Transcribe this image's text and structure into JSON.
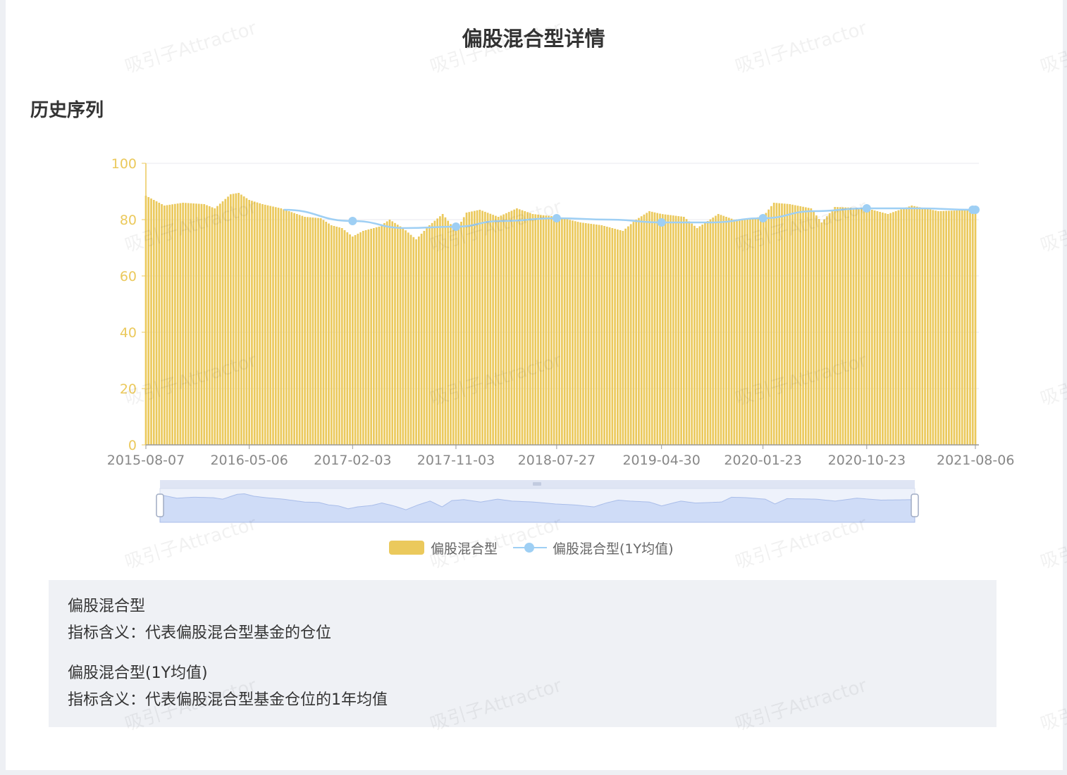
{
  "title": "偏股混合型详情",
  "section_title": "历史序列",
  "watermark": "吸引子Attractor",
  "colors": {
    "bar": "#ebc95c",
    "line": "#9ecff4",
    "axis_label": "#ebc95c",
    "zoom_fill": "#cfdcf7"
  },
  "legend": [
    {
      "name": "偏股混合型",
      "icon": "bar-swatch"
    },
    {
      "name": "偏股混合型(1Y均值)",
      "icon": "line-dot-swatch"
    }
  ],
  "descriptions": [
    {
      "name": "偏股混合型",
      "meaning": "指标含义：代表偏股混合型基金的仓位"
    },
    {
      "name": "偏股混合型(1Y均值)",
      "meaning": "指标含义：代表偏股混合型基金仓位的1年均值"
    }
  ],
  "chart_data": {
    "type": "bar",
    "x_ticks": [
      "2015-08-07",
      "2016-05-06",
      "2017-02-03",
      "2017-11-03",
      "2018-07-27",
      "2019-04-30",
      "2020-01-23",
      "2020-10-23",
      "2021-08-06"
    ],
    "ylim": [
      0,
      100
    ],
    "y_ticks": [
      0,
      20,
      40,
      60,
      80,
      100
    ],
    "grid": true,
    "legend_position": "bottom",
    "series": [
      {
        "name": "偏股混合型",
        "type": "bar",
        "anchors": [
          [
            "2015-08-07",
            88.5
          ],
          [
            "2015-09-25",
            85
          ],
          [
            "2015-11-13",
            86
          ],
          [
            "2016-01-08",
            85.5
          ],
          [
            "2016-02-05",
            84
          ],
          [
            "2016-03-18",
            89
          ],
          [
            "2016-04-08",
            89.5
          ],
          [
            "2016-05-06",
            87
          ],
          [
            "2016-06-10",
            85.5
          ],
          [
            "2016-07-29",
            84
          ],
          [
            "2016-09-30",
            81
          ],
          [
            "2016-11-11",
            80.5
          ],
          [
            "2016-12-09",
            78
          ],
          [
            "2017-01-06",
            77
          ],
          [
            "2017-02-03",
            74
          ],
          [
            "2017-03-03",
            76
          ],
          [
            "2017-04-14",
            77.5
          ],
          [
            "2017-05-12",
            80
          ],
          [
            "2017-06-16",
            77
          ],
          [
            "2017-07-21",
            73
          ],
          [
            "2017-08-25",
            78
          ],
          [
            "2017-09-29",
            82
          ],
          [
            "2017-11-03",
            76
          ],
          [
            "2017-12-01",
            82.5
          ],
          [
            "2018-01-05",
            83.5
          ],
          [
            "2018-02-23",
            81
          ],
          [
            "2018-04-13",
            84
          ],
          [
            "2018-05-25",
            82
          ],
          [
            "2018-07-27",
            81
          ],
          [
            "2018-09-28",
            79
          ],
          [
            "2018-11-23",
            78
          ],
          [
            "2019-01-18",
            76
          ],
          [
            "2019-02-22",
            80
          ],
          [
            "2019-03-29",
            83
          ],
          [
            "2019-04-30",
            82
          ],
          [
            "2019-06-28",
            81
          ],
          [
            "2019-08-02",
            77
          ],
          [
            "2019-09-27",
            82
          ],
          [
            "2019-11-08",
            80
          ],
          [
            "2020-01-23",
            81
          ],
          [
            "2020-02-21",
            86
          ],
          [
            "2020-04-03",
            85.5
          ],
          [
            "2020-05-29",
            84
          ],
          [
            "2020-06-26",
            79
          ],
          [
            "2020-07-31",
            84.5
          ],
          [
            "2020-10-23",
            84
          ],
          [
            "2020-12-18",
            82
          ],
          [
            "2021-02-19",
            85
          ],
          [
            "2021-04-30",
            83
          ],
          [
            "2021-08-06",
            83.5
          ]
        ]
      },
      {
        "name": "偏股混合型(1Y均值)",
        "type": "line",
        "values": [
          [
            "2016-08-05",
            83.5
          ],
          [
            "2017-02-03",
            79.5
          ],
          [
            "2017-06-23",
            77
          ],
          [
            "2017-11-03",
            77.5
          ],
          [
            "2018-03-02",
            79.5
          ],
          [
            "2018-07-27",
            80.5
          ],
          [
            "2018-12-14",
            80
          ],
          [
            "2019-04-30",
            79
          ],
          [
            "2019-09-06",
            79
          ],
          [
            "2020-01-23",
            80.5
          ],
          [
            "2020-06-05",
            83
          ],
          [
            "2020-10-23",
            84
          ],
          [
            "2021-03-12",
            84
          ],
          [
            "2021-07-30",
            83.5
          ],
          [
            "2021-08-06",
            83.5
          ]
        ],
        "markers": [
          "2017-02-03",
          "2017-11-03",
          "2018-07-27",
          "2019-04-30",
          "2020-01-23",
          "2020-10-23",
          "2021-07-30",
          "2021-08-06"
        ]
      }
    ]
  }
}
